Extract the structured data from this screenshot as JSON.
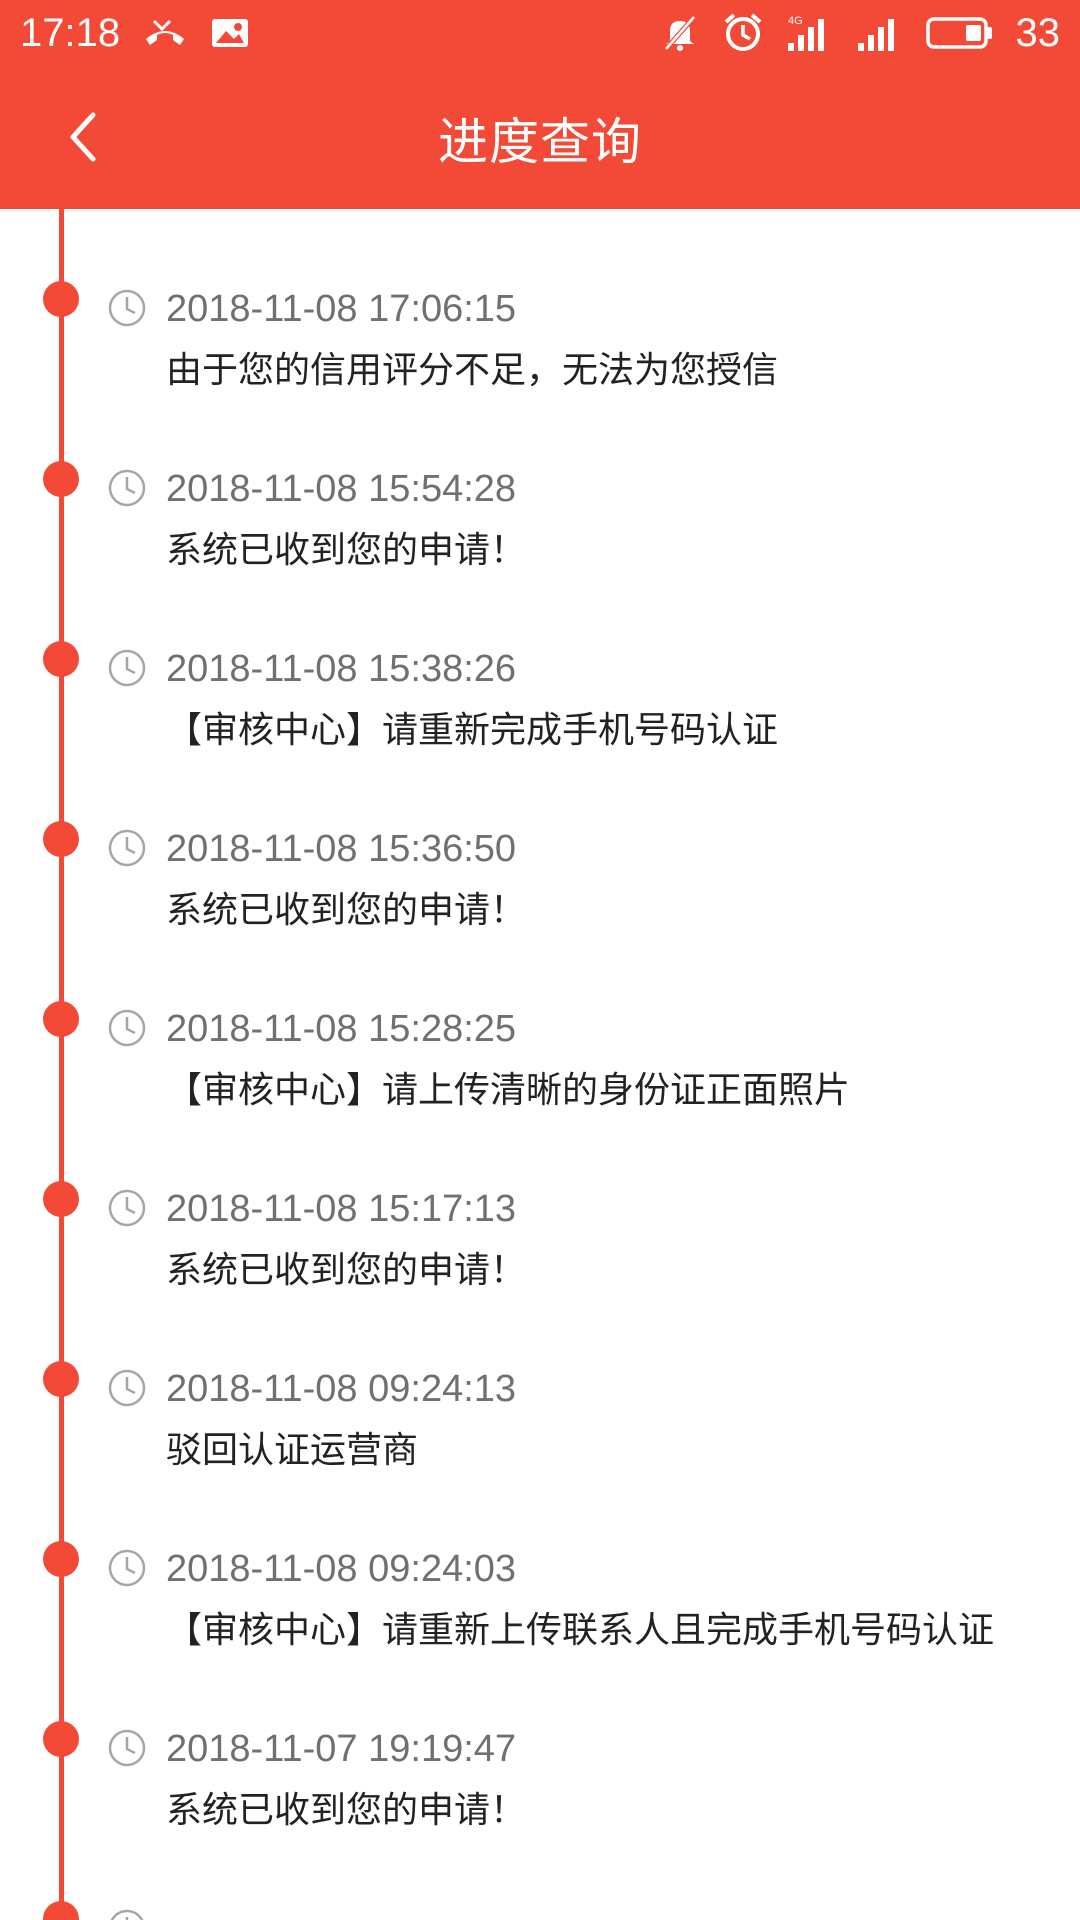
{
  "status_bar": {
    "time": "17:18",
    "battery_level": "33",
    "icons": [
      "missed-call-icon",
      "image-notification-icon",
      "mute-icon",
      "alarm-icon",
      "signal-4g-icon",
      "signal-icon",
      "battery-icon"
    ]
  },
  "header": {
    "title": "进度查询",
    "back_icon": "chevron-left-icon"
  },
  "colors": {
    "accent": "#f34a38",
    "timestamp": "#707070",
    "message": "#222222"
  },
  "timeline": [
    {
      "timestamp": "2018-11-08 17:06:15",
      "message": "由于您的信用评分不足，无法为您授信"
    },
    {
      "timestamp": "2018-11-08 15:54:28",
      "message": "系统已收到您的申请！"
    },
    {
      "timestamp": "2018-11-08 15:38:26",
      "message": "【审核中心】请重新完成手机号码认证"
    },
    {
      "timestamp": "2018-11-08 15:36:50",
      "message": "系统已收到您的申请！"
    },
    {
      "timestamp": "2018-11-08 15:28:25",
      "message": "【审核中心】请上传清晰的身份证正面照片"
    },
    {
      "timestamp": "2018-11-08 15:17:13",
      "message": "系统已收到您的申请！"
    },
    {
      "timestamp": "2018-11-08 09:24:13",
      "message": "驳回认证运营商"
    },
    {
      "timestamp": "2018-11-08 09:24:03",
      "message": "【审核中心】请重新上传联系人且完成手机号码认证"
    },
    {
      "timestamp": "2018-11-07 19:19:47",
      "message": "系统已收到您的申请！"
    }
  ]
}
